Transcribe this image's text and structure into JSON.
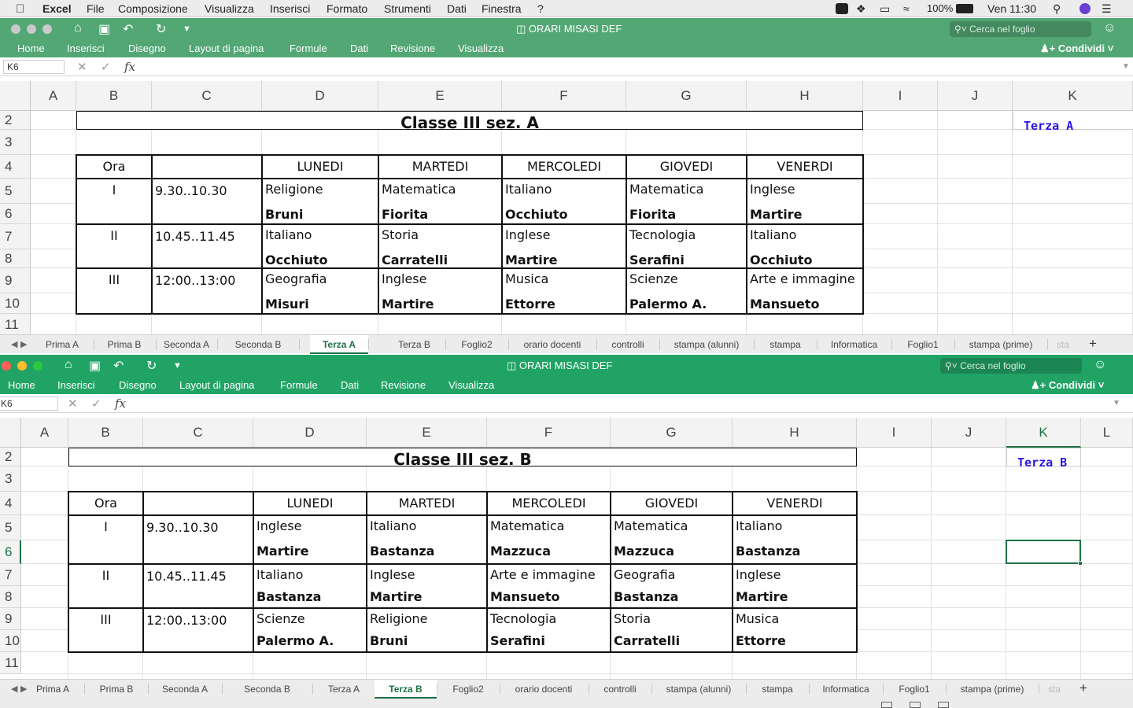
{
  "menubar": {
    "apple_icon": "apple-icon",
    "app": "Excel",
    "items": [
      "File",
      "Composizione",
      "Visualizza",
      "Inserisci",
      "Formato",
      "Strumenti",
      "Dati",
      "Finestra",
      "?"
    ],
    "battery": "100%",
    "clock": "Ven 11:30"
  },
  "ribbon_tabs": [
    "Home",
    "Inserisci",
    "Disegno",
    "Layout di pagina",
    "Formule",
    "Dati",
    "Revisione",
    "Visualizza"
  ],
  "search_placeholder": "Cerca nel foglio",
  "share_label": "Condividi",
  "formula_bar": {
    "fx": "fx",
    "namebox": "K6"
  },
  "columns": [
    "A",
    "B",
    "C",
    "D",
    "E",
    "F",
    "G",
    "H",
    "I",
    "J",
    "K"
  ],
  "sheet_tabs": [
    "Prima A",
    "Prima B",
    "Seconda A",
    "Seconda B",
    "Terza A",
    "Terza B",
    "Foglio2",
    "orario docenti",
    "controlli",
    "stampa (alunni)",
    "stampa",
    "Informatica",
    "Foglio1",
    "stampa (prime)",
    "sta"
  ],
  "windows": [
    {
      "doc_title": "ORARI MISASI DEF",
      "namebox": "K6",
      "active_tab": "Terza A",
      "title": "Classe III sez. A",
      "k_label": "Terza A",
      "row_numbers": [
        "2",
        "3",
        "4",
        "5",
        "6",
        "7",
        "8",
        "9",
        "10",
        "11"
      ],
      "head": {
        "ora": "Ora",
        "days": [
          "LUNEDI",
          "MARTEDI",
          "MERCOLEDI",
          "GIOVEDI",
          "VENERDI"
        ]
      },
      "periods": [
        {
          "num": "I",
          "time": "9.30..10.30",
          "subjects": [
            "Religione",
            "Matematica",
            "Italiano",
            "Matematica",
            "Inglese"
          ],
          "teachers": [
            "Bruni",
            "Fiorita",
            "Occhiuto",
            "Fiorita",
            "Martire"
          ]
        },
        {
          "num": "II",
          "time": "10.45..11.45",
          "subjects": [
            "Italiano",
            "Storia",
            "Inglese",
            "Tecnologia",
            "Italiano"
          ],
          "teachers": [
            "Occhiuto",
            "Carratelli",
            "Martire",
            "Serafini",
            "Occhiuto"
          ]
        },
        {
          "num": "III",
          "time": "12:00..13:00",
          "subjects": [
            "Geografia",
            "Inglese",
            "Musica",
            "Scienze",
            "Arte e immagine"
          ],
          "teachers": [
            "Misuri",
            "Martire",
            "Ettorre",
            "Palermo A.",
            "Mansueto"
          ]
        }
      ]
    },
    {
      "doc_title": "ORARI MISASI DEF",
      "namebox": "K6",
      "active_tab": "Terza B",
      "title": "Classe III sez. B",
      "k_label": "Terza B",
      "extra_col": "L",
      "row_numbers": [
        "2",
        "3",
        "4",
        "5",
        "6",
        "7",
        "8",
        "9",
        "10",
        "11"
      ],
      "head": {
        "ora": "Ora",
        "days": [
          "LUNEDI",
          "MARTEDI",
          "MERCOLEDI",
          "GIOVEDI",
          "VENERDI"
        ]
      },
      "periods": [
        {
          "num": "I",
          "time": "9.30..10.30",
          "subjects": [
            "Inglese",
            "Italiano",
            "Matematica",
            "Matematica",
            "Italiano"
          ],
          "teachers": [
            "Martire",
            "Bastanza",
            "Mazzuca",
            "Mazzuca",
            "Bastanza"
          ]
        },
        {
          "num": "II",
          "time": "10.45..11.45",
          "subjects": [
            "Italiano",
            "Inglese",
            "Arte e immagine",
            "Geografia",
            "Inglese"
          ],
          "teachers": [
            "Bastanza",
            "Martire",
            "Mansueto",
            "Bastanza",
            "Martire"
          ]
        },
        {
          "num": "III",
          "time": "12:00..13:00",
          "subjects": [
            "Scienze",
            "Religione",
            "Tecnologia",
            "Storia",
            "Musica"
          ],
          "teachers": [
            "Palermo A.",
            "Bruni",
            "Serafini",
            "Carratelli",
            "Ettorre"
          ]
        }
      ]
    }
  ]
}
